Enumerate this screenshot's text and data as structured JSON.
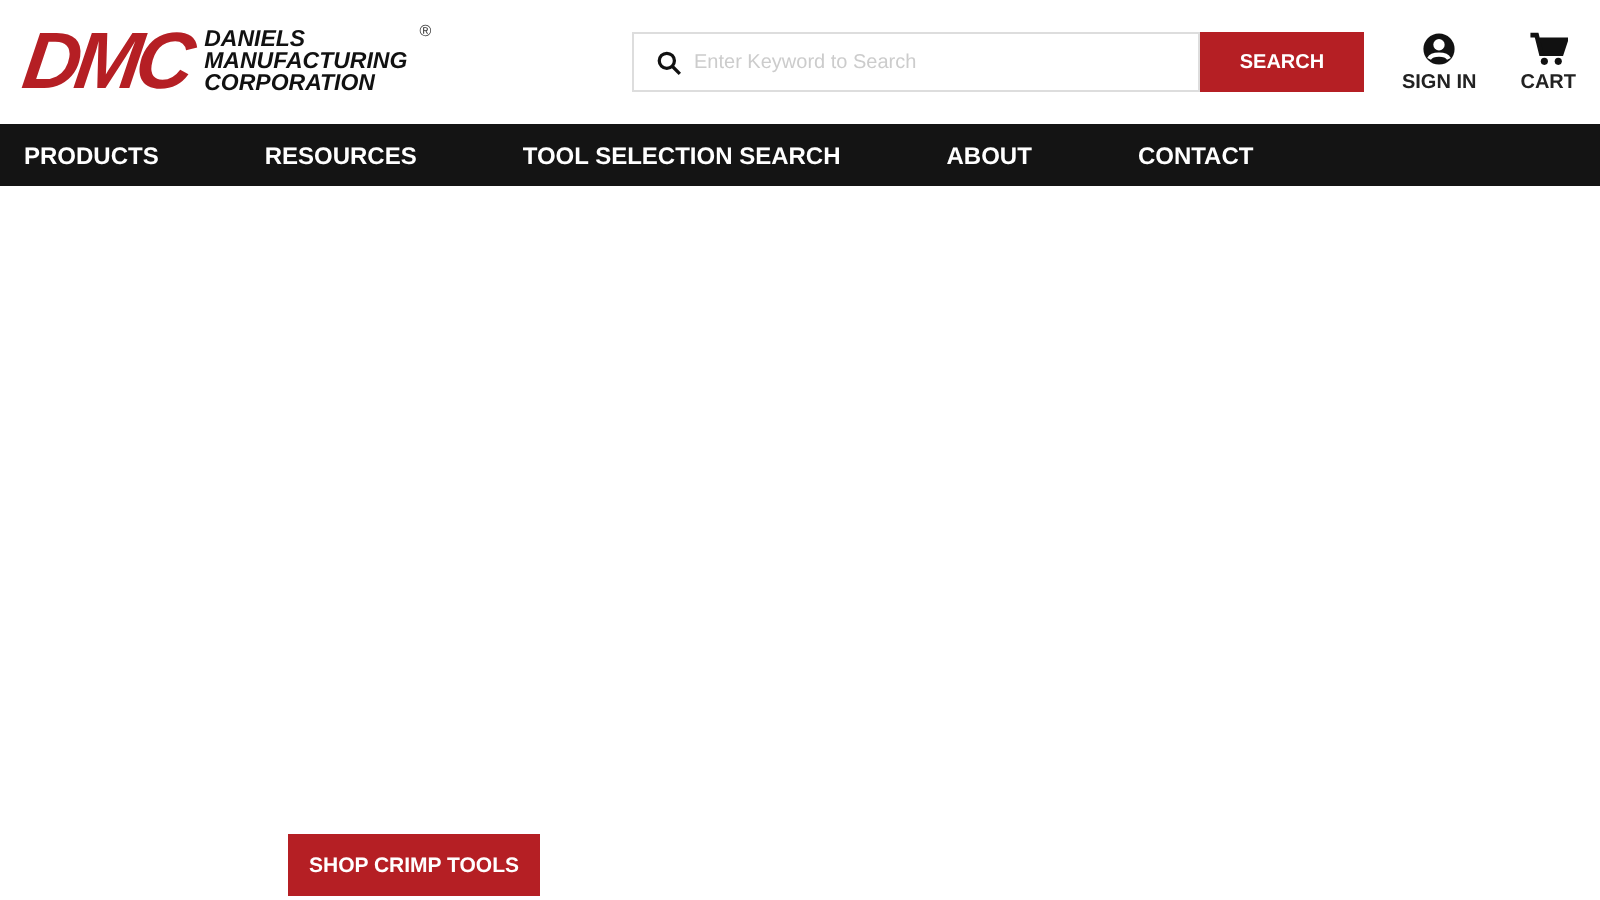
{
  "logo": {
    "mark": "DMC",
    "name_lines": [
      "DANIELS",
      "MANUFACTURING",
      "CORPORATION"
    ],
    "registered": "®"
  },
  "search": {
    "placeholder": "Enter Keyword to Search",
    "button": "SEARCH"
  },
  "account": [
    {
      "kind": "user",
      "label": "SIGN IN"
    },
    {
      "kind": "cart",
      "label": "CART"
    }
  ],
  "nav": [
    "PRODUCTS",
    "RESOURCES",
    "TOOL SELECTION SEARCH",
    "ABOUT",
    "CONTACT"
  ],
  "hero": {
    "button": "SHOP CRIMP TOOLS"
  }
}
